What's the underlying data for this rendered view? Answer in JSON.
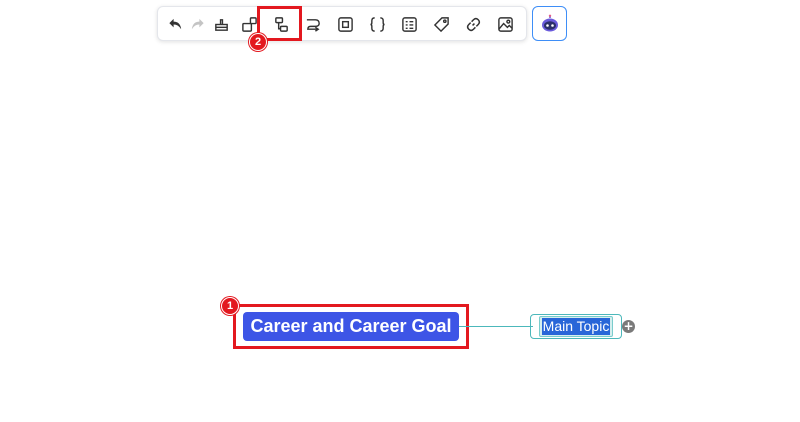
{
  "toolbar": {
    "buttons": [
      {
        "name": "undo",
        "icon": "undo-icon",
        "enabled": true
      },
      {
        "name": "redo",
        "icon": "redo-icon",
        "enabled": false
      },
      {
        "name": "format-painter",
        "icon": "format-painter-icon",
        "enabled": true
      },
      {
        "name": "insert-topic",
        "icon": "insert-topic-icon",
        "enabled": true
      },
      {
        "name": "insert-subtopic",
        "icon": "subtopic-icon",
        "enabled": true
      },
      {
        "name": "relationship",
        "icon": "relationship-icon",
        "enabled": true
      },
      {
        "name": "boundary",
        "icon": "boundary-icon",
        "enabled": true
      },
      {
        "name": "summary",
        "icon": "summary-braces-icon",
        "enabled": true
      },
      {
        "name": "note",
        "icon": "note-icon",
        "enabled": true
      },
      {
        "name": "label",
        "icon": "tag-icon",
        "enabled": true
      },
      {
        "name": "link",
        "icon": "link-icon",
        "enabled": true
      },
      {
        "name": "image",
        "icon": "image-icon",
        "enabled": true
      }
    ],
    "ai_button": {
      "icon": "ai-robot-icon"
    }
  },
  "annotations": {
    "step1": "1",
    "step2": "2"
  },
  "mindmap": {
    "central_topic": "Career and Career Goal",
    "main_topic": "Main Topic",
    "add_child_symbol": "+"
  },
  "colors": {
    "central_topic_bg": "#3d55e6",
    "connector": "#4cb8bb",
    "highlight": "#e3181f",
    "selection": "#2866d8",
    "ai_border": "#3e8ef7"
  }
}
